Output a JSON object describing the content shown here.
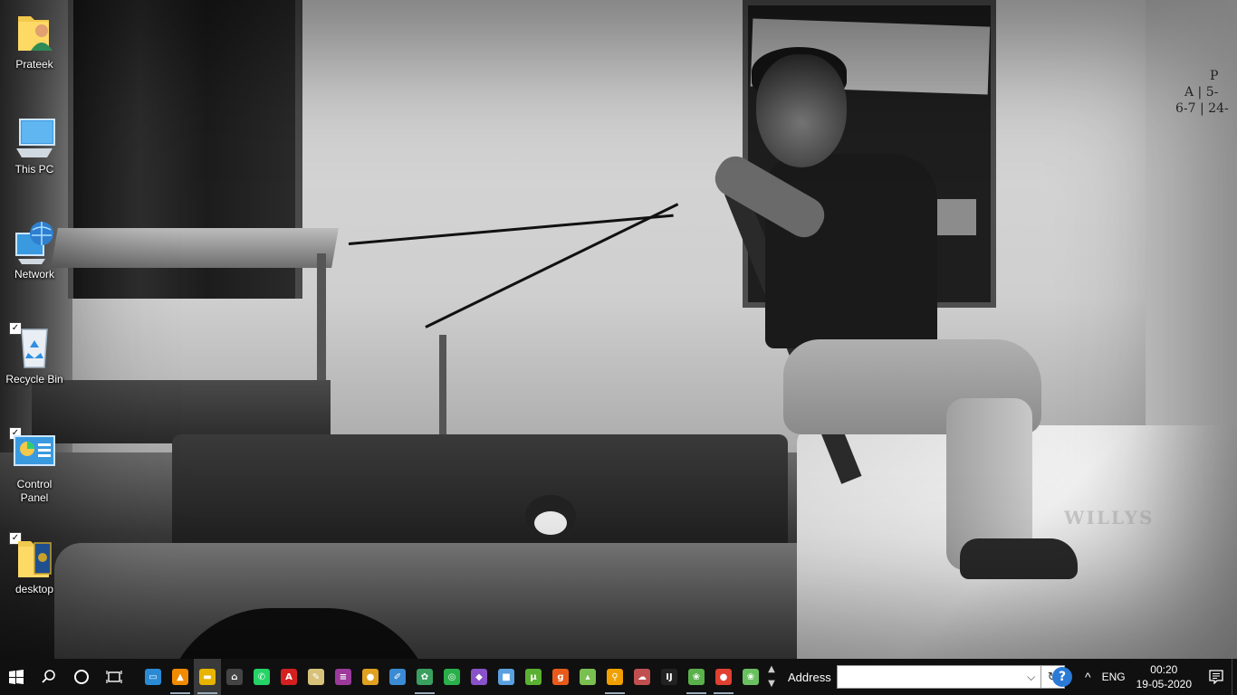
{
  "desktop": {
    "icons": [
      {
        "label": "Prateek",
        "icon": "user-folder-icon",
        "checked": false
      },
      {
        "label": "This PC",
        "icon": "computer-icon",
        "checked": false
      },
      {
        "label": "Network",
        "icon": "network-icon",
        "checked": false
      },
      {
        "label": "Recycle Bin",
        "icon": "recycle-bin-icon",
        "checked": true
      },
      {
        "label": "Control Panel",
        "icon": "control-panel-icon",
        "checked": true
      },
      {
        "label": "desktop",
        "icon": "folder-icon",
        "checked": true
      }
    ],
    "wallpaper": {
      "chalk_text": [
        "P",
        "A | 5-",
        "6-7 | 24-"
      ],
      "vehicle_text": "WILLYS"
    }
  },
  "taskbar": {
    "start_icon": "windows-start-icon",
    "search_icon": "search-icon",
    "cortana_icon": "cortana-icon",
    "task_view_icon": "task-view-icon",
    "pinned": [
      {
        "name": "monitor-app-icon",
        "glyph": "▭",
        "color": "#2a8ad4"
      },
      {
        "name": "vlc-icon",
        "glyph": "▲",
        "color": "#f08a00"
      },
      {
        "name": "file-explorer-icon",
        "glyph": "▬",
        "color": "#e8b400"
      },
      {
        "name": "home-app-icon",
        "glyph": "⌂",
        "color": "#444444"
      },
      {
        "name": "whatsapp-icon",
        "glyph": "✆",
        "color": "#25d366"
      },
      {
        "name": "pdf-reader-icon",
        "glyph": "A",
        "color": "#d42020"
      },
      {
        "name": "notepad-icon",
        "glyph": "✎",
        "color": "#d8c27a"
      },
      {
        "name": "dev-tool-icon",
        "glyph": "≡",
        "color": "#9c3a9c"
      },
      {
        "name": "chrome-icon",
        "glyph": "●",
        "color": "#e0a020"
      },
      {
        "name": "paint-icon",
        "glyph": "✐",
        "color": "#3a8ad4"
      },
      {
        "name": "xampp-icon",
        "glyph": "✿",
        "color": "#3aa060"
      },
      {
        "name": "refresh-app-icon",
        "glyph": "◎",
        "color": "#2ab04a"
      },
      {
        "name": "visual-studio-icon",
        "glyph": "◆",
        "color": "#8a52c8"
      },
      {
        "name": "virtualbox-icon",
        "glyph": "■",
        "color": "#5aa0e0"
      },
      {
        "name": "utorrent-icon",
        "glyph": "µ",
        "color": "#5ab030"
      },
      {
        "name": "g-app-icon",
        "glyph": "g",
        "color": "#e85a1a"
      },
      {
        "name": "android-studio-icon",
        "glyph": "▴",
        "color": "#7ac050"
      },
      {
        "name": "search-app-icon",
        "glyph": "⚲",
        "color": "#f0a000"
      },
      {
        "name": "network-app-icon",
        "glyph": "☁",
        "color": "#c05050"
      },
      {
        "name": "intellij-icon",
        "glyph": "IJ",
        "color": "#222222"
      },
      {
        "name": "spring-tool-icon",
        "glyph": "❀",
        "color": "#5ab04a"
      },
      {
        "name": "chrome-icon-2",
        "glyph": "●",
        "color": "#e04030"
      },
      {
        "name": "spring-tool-icon-2",
        "glyph": "❀",
        "color": "#6ac060"
      }
    ],
    "address": {
      "label": "Address",
      "value": "",
      "placeholder": ""
    },
    "tray": {
      "help_icon": "?",
      "chevron": "^",
      "language": "ENG",
      "time": "00:20",
      "date": "19-05-2020"
    }
  }
}
